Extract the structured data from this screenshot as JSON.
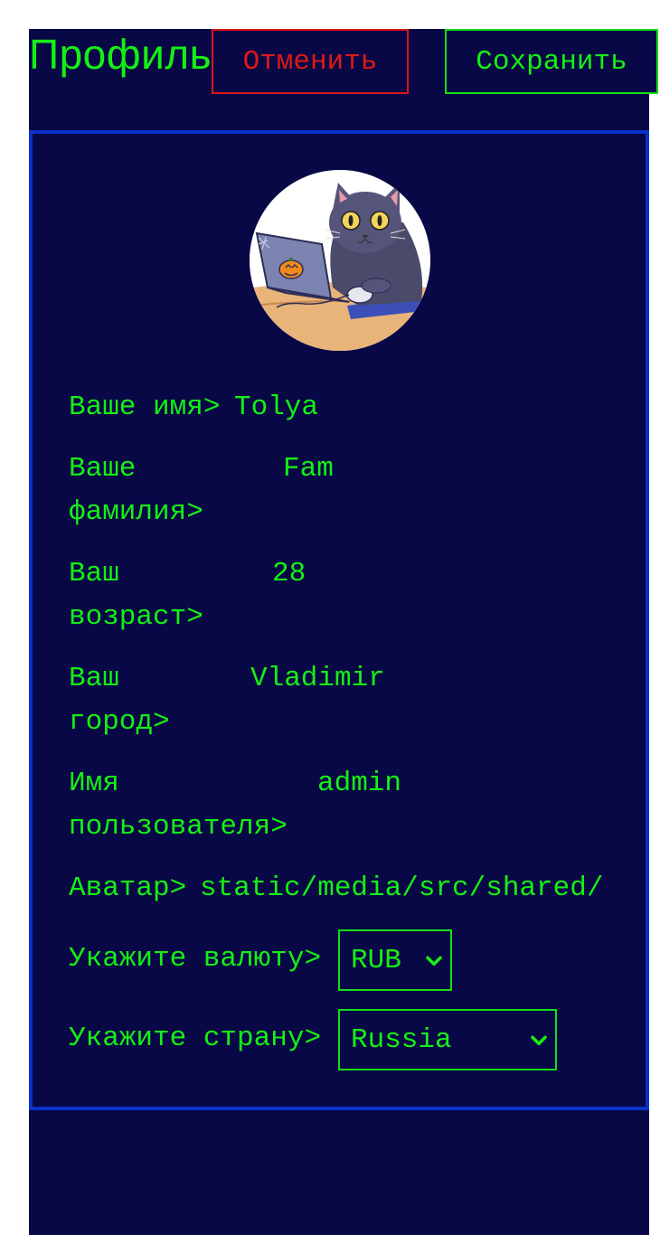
{
  "header": {
    "title": "Профиль",
    "cancel_label": "Отменить",
    "save_label": "Сохранить"
  },
  "profile": {
    "avatar_icon": "cat-at-laptop-avatar",
    "fields": [
      {
        "label_line1": "Ваше имя>",
        "label_line2": "",
        "value": "Tolya"
      },
      {
        "label_line1": "Ваше",
        "label_line2": "фамилия>",
        "value": "Fam"
      },
      {
        "label_line1": "Ваш",
        "label_line2": "возраст>",
        "value": "28"
      },
      {
        "label_line1": "Ваш",
        "label_line2": "город>",
        "value": "Vladimir"
      },
      {
        "label_line1": "Имя",
        "label_line2": "пользователя>",
        "value": "admin"
      },
      {
        "label_line1": "Аватар>",
        "label_line2": "",
        "value": "static/media/src/shared/"
      }
    ],
    "currency": {
      "label": "Укажите валюту>",
      "selected": "RUB"
    },
    "country": {
      "label": "Укажите страну>",
      "selected": "Russia"
    }
  },
  "colors": {
    "background": "#080846",
    "text": "#14f014",
    "cancel": "#e01818",
    "card_border": "#0a32c8"
  }
}
